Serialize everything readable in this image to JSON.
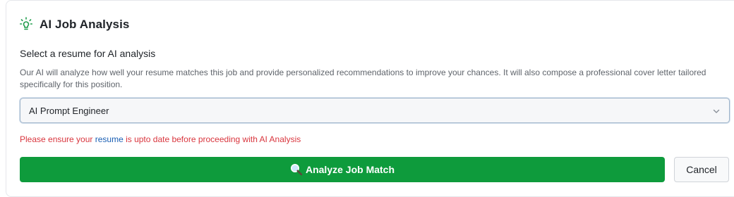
{
  "header": {
    "title": "AI Job Analysis",
    "icon": "lightbulb-icon",
    "icon_color": "#1f9d4c"
  },
  "resume_select": {
    "label": "Select a resume for AI analysis",
    "description": "Our AI will analyze how well your resume matches this job and provide personalized recommendations to improve your chances. It will also compose a professional cover letter tailored specifically for this position.",
    "selected_value": "AI Prompt Engineer",
    "icon": "chevron-down-icon"
  },
  "warning": {
    "prefix": "Please ensure your ",
    "link_text": "resume",
    "suffix": " is upto date before proceeding with AI Analysis",
    "color": "#d9363e",
    "link_color": "#1a5fb4"
  },
  "actions": {
    "analyze_label": "Analyze Job Match",
    "analyze_icon": "magnifier-icon",
    "analyze_color": "#0e9b3c",
    "cancel_label": "Cancel"
  }
}
